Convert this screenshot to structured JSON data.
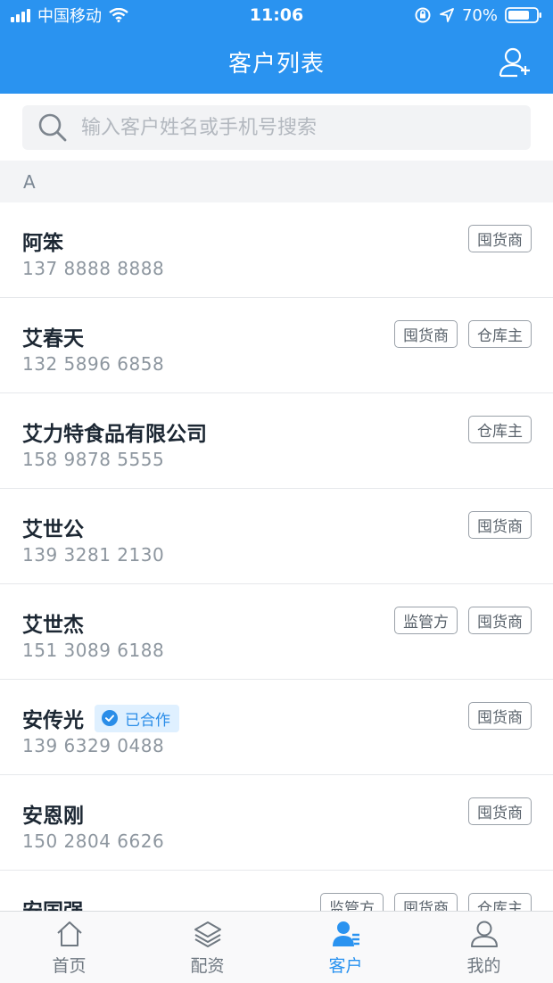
{
  "status_bar": {
    "carrier": "中国移动",
    "time": "11:06",
    "battery_percent": "70%"
  },
  "header": {
    "title": "客户列表",
    "add_icon": "add-user-icon"
  },
  "search": {
    "placeholder": "输入客户姓名或手机号搜索"
  },
  "section": {
    "letter": "A"
  },
  "customers": [
    {
      "name": "阿笨",
      "phone": "137 8888 8888",
      "tags": [
        "囤货商"
      ],
      "badge": ""
    },
    {
      "name": "艾春天",
      "phone": "132 5896 6858",
      "tags": [
        "囤货商",
        "仓库主"
      ],
      "badge": ""
    },
    {
      "name": "艾力特食品有限公司",
      "phone": "158 9878 5555",
      "tags": [
        "仓库主"
      ],
      "badge": ""
    },
    {
      "name": "艾世公",
      "phone": "139 3281 2130",
      "tags": [
        "囤货商"
      ],
      "badge": ""
    },
    {
      "name": "艾世杰",
      "phone": "151 3089 6188",
      "tags": [
        "监管方",
        "囤货商"
      ],
      "badge": ""
    },
    {
      "name": "安传光",
      "phone": "139 6329 0488",
      "tags": [
        "囤货商"
      ],
      "badge": "已合作"
    },
    {
      "name": "安恩刚",
      "phone": "150 2804 6626",
      "tags": [
        "囤货商"
      ],
      "badge": ""
    },
    {
      "name": "安国强",
      "phone": "",
      "tags": [
        "监管方",
        "囤货商",
        "仓库主"
      ],
      "badge": ""
    }
  ],
  "tabbar": {
    "items": [
      {
        "label": "首页",
        "icon": "home-icon"
      },
      {
        "label": "配资",
        "icon": "layers-icon"
      },
      {
        "label": "客户",
        "icon": "customer-icon"
      },
      {
        "label": "我的",
        "icon": "profile-icon"
      }
    ],
    "active_index": 2
  },
  "colors": {
    "primary": "#2a93f0",
    "badge_bg": "#dff0ff"
  }
}
